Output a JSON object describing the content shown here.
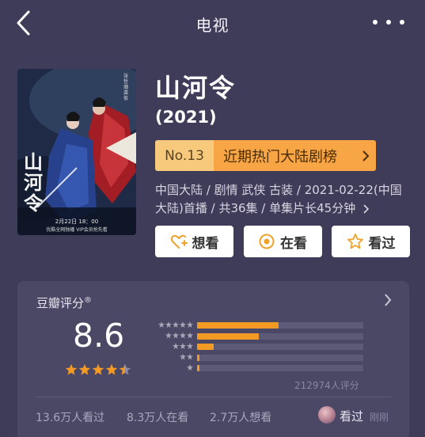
{
  "header": {
    "title": "电视"
  },
  "poster": {
    "title_vertical": "山河令",
    "air_date": "2月22日 18：00",
    "subtitle": "优酷全网独播 VIP会员抢先看"
  },
  "show": {
    "title": "山河令",
    "year": "(2021)",
    "rank_no": "No.13",
    "rank_name": "近期热门大陆剧榜",
    "meta": "中国大陆 / 剧情 武侠 古装 / 2021-02-22(中国大陆)首播 / 共36集 / 单集片长45分钟"
  },
  "actions": {
    "want": "想看",
    "watching": "在看",
    "watched": "看过"
  },
  "rating": {
    "label": "豆瓣评分",
    "mark": "®",
    "score": "8.6",
    "stars_value": 4.5,
    "distribution": [
      0.49,
      0.37,
      0.1,
      0.015,
      0.015
    ],
    "count": "212974人评分"
  },
  "stats": {
    "watched": "13.6万人看过",
    "watching": "8.3万人在看",
    "want": "2.7万人想看"
  },
  "recent": {
    "label": "看过",
    "time": "刚刚"
  },
  "colors": {
    "background": "#3f3c5a",
    "card": "#4b4866",
    "accent": "#f39a24",
    "rank_light": "#f6c97c",
    "rank_dark": "#f8a545"
  },
  "icons": {
    "back": "chevron-left-icon",
    "more": "ellipsis-icon",
    "want": "heart-plus-icon",
    "watching": "target-circle-icon",
    "watched": "star-outline-icon"
  }
}
